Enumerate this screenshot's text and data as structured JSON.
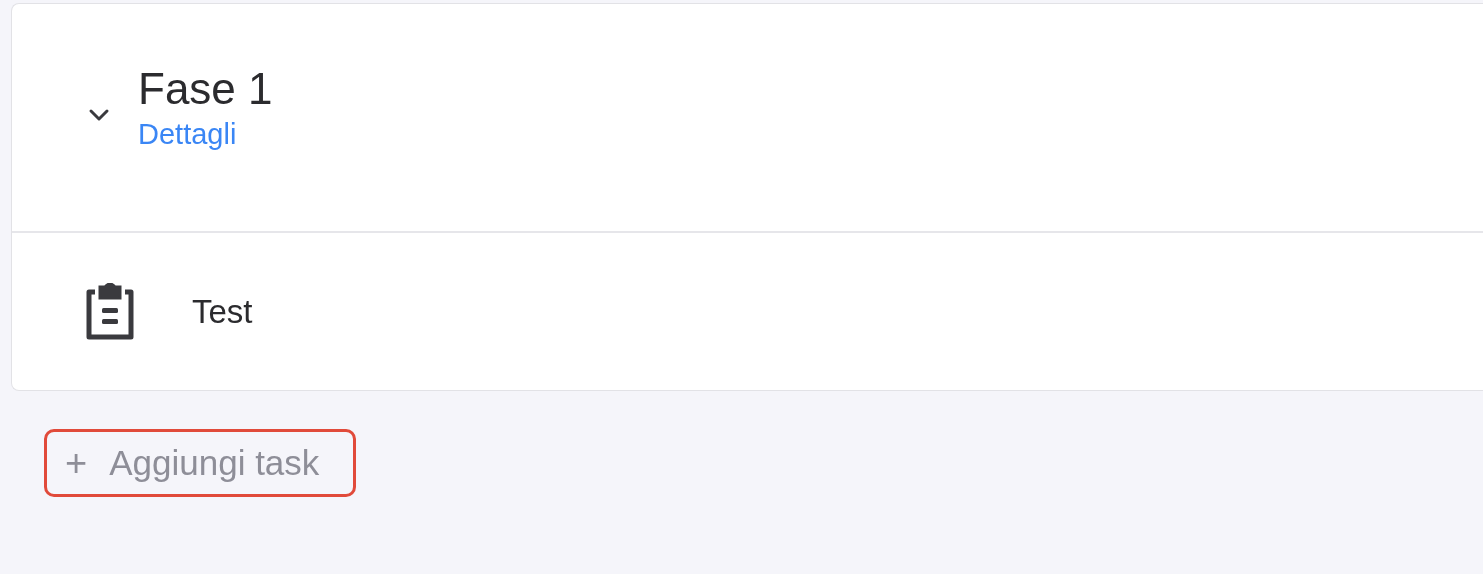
{
  "phase": {
    "title": "Fase 1",
    "details_link": "Dettagli",
    "expanded": true
  },
  "tasks": [
    {
      "name": "Test"
    }
  ],
  "add_task_button": {
    "label": "Aggiungi task",
    "icon": "+",
    "highlighted": true
  }
}
